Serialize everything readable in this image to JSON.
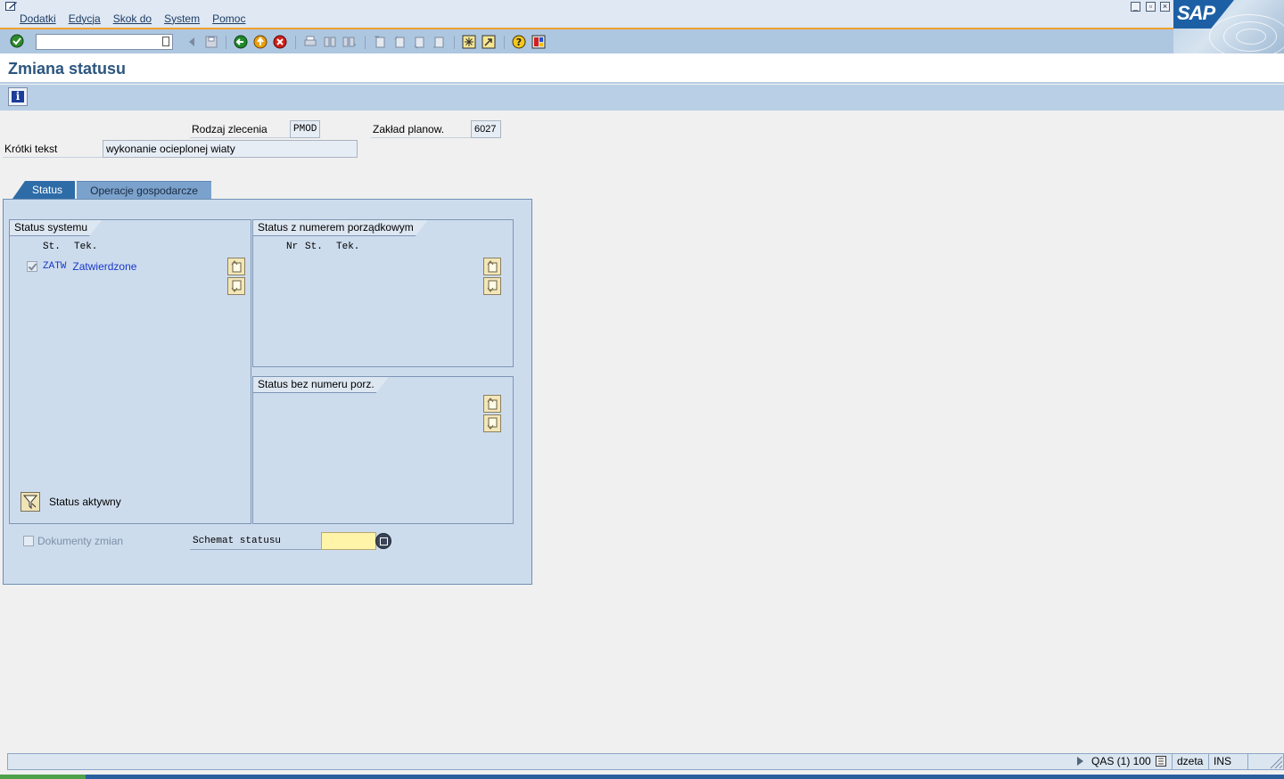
{
  "menubar": {
    "items": [
      "Dodatki",
      "Edycja",
      "Skok do",
      "System",
      "Pomoc"
    ]
  },
  "toolbar": {
    "command_value": ""
  },
  "logo": {
    "text": "SAP"
  },
  "title": "Zmiana statusu",
  "header": {
    "order_type_label": "Rodzaj zlecenia",
    "order_type_value": "PMOD",
    "plant_label": "Zakład planow.",
    "plant_value": "6027",
    "short_text_label": "Krótki tekst",
    "short_text_value": "wykonanie ocieplonej wiaty"
  },
  "tabs": [
    {
      "label": "Status",
      "active": true
    },
    {
      "label": "Operacje gospodarcze",
      "active": false
    }
  ],
  "system_status": {
    "title": "Status systemu",
    "col_st": "St.",
    "col_tek": "Tek.",
    "rows": [
      {
        "code": "ZATW",
        "text": "Zatwierdzone",
        "checked": true
      }
    ],
    "active_label": "Status aktywny"
  },
  "numbered_status": {
    "title": "Status z numerem porządkowym",
    "col_nr": "Nr",
    "col_st": "St.",
    "col_tek": "Tek."
  },
  "unnumbered_status": {
    "title": "Status bez numeru porz."
  },
  "change_docs": {
    "label": "Dokumenty zmian",
    "checked": false
  },
  "schema": {
    "label": "Schemat statusu",
    "value": ""
  },
  "statusbar": {
    "system": "QAS (1) 100",
    "user": "dzeta",
    "mode": "INS"
  },
  "colors": {
    "toolbar": "#aec7e1",
    "title": "#2c5680",
    "tab_active": "#2e6ca8",
    "panel": "#cddced",
    "required_field": "#fff4a8",
    "status_link": "#1a38c8"
  }
}
